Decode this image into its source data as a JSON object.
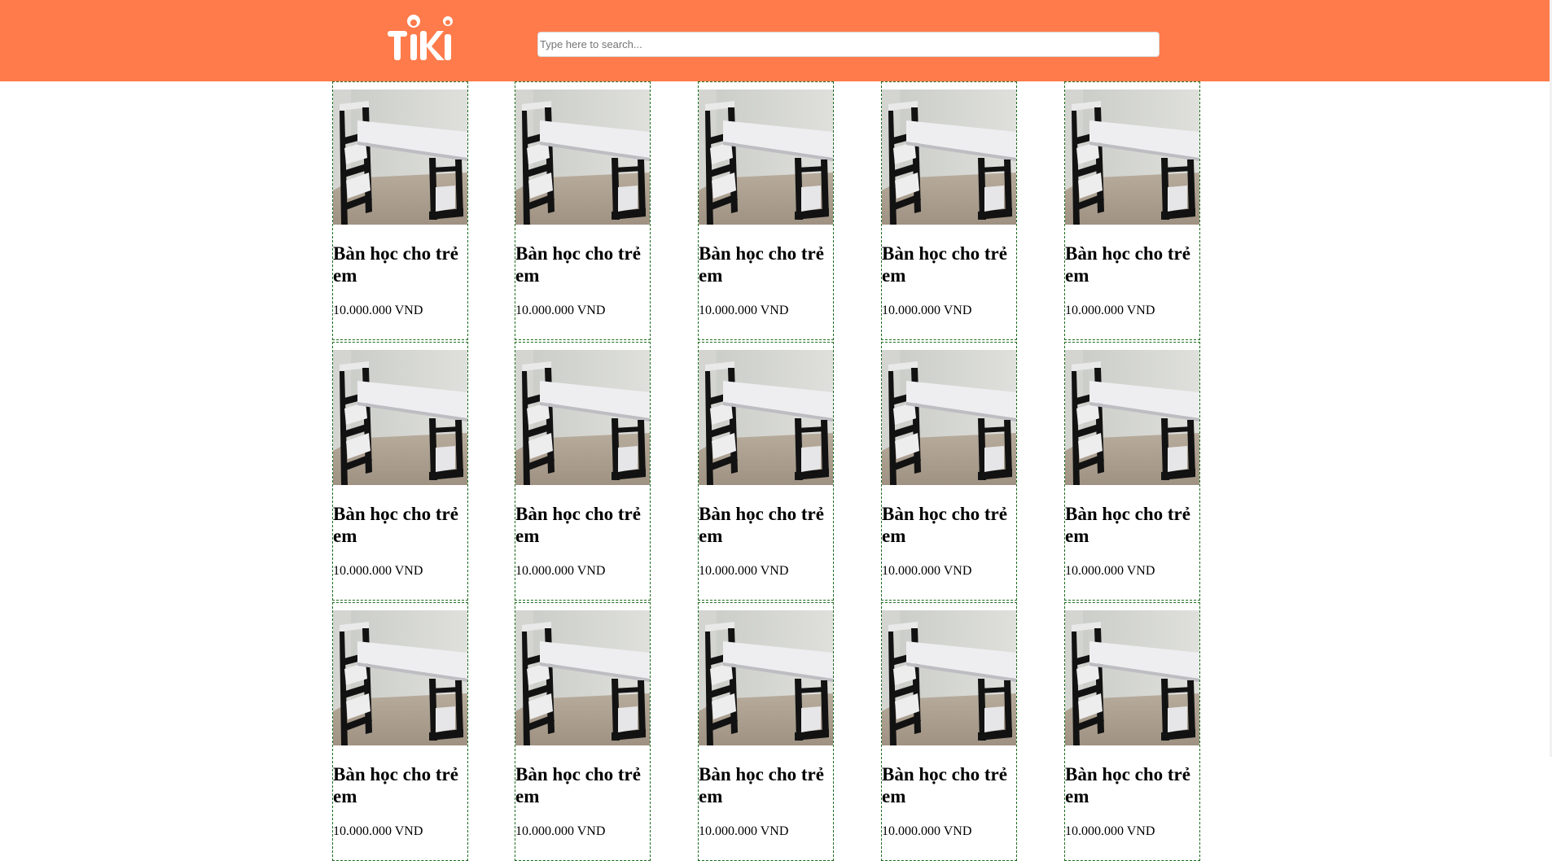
{
  "header": {
    "logo_text": "TIKI",
    "search_placeholder": "Type here to search..."
  },
  "products": [
    {
      "name": "Bàn học cho trẻ em",
      "price": "10.000.000 VND"
    },
    {
      "name": "Bàn học cho trẻ em",
      "price": "10.000.000 VND"
    },
    {
      "name": "Bàn học cho trẻ em",
      "price": "10.000.000 VND"
    },
    {
      "name": "Bàn học cho trẻ em",
      "price": "10.000.000 VND"
    },
    {
      "name": "Bàn học cho trẻ em",
      "price": "10.000.000 VND"
    },
    {
      "name": "Bàn học cho trẻ em",
      "price": "10.000.000 VND"
    },
    {
      "name": "Bàn học cho trẻ em",
      "price": "10.000.000 VND"
    },
    {
      "name": "Bàn học cho trẻ em",
      "price": "10.000.000 VND"
    },
    {
      "name": "Bàn học cho trẻ em",
      "price": "10.000.000 VND"
    },
    {
      "name": "Bàn học cho trẻ em",
      "price": "10.000.000 VND"
    },
    {
      "name": "Bàn học cho trẻ em",
      "price": "10.000.000 VND"
    },
    {
      "name": "Bàn học cho trẻ em",
      "price": "10.000.000 VND"
    },
    {
      "name": "Bàn học cho trẻ em",
      "price": "10.000.000 VND"
    },
    {
      "name": "Bàn học cho trẻ em",
      "price": "10.000.000 VND"
    },
    {
      "name": "Bàn học cho trẻ em",
      "price": "10.000.000 VND"
    }
  ],
  "colors": {
    "header_bg": "#ff7b4b",
    "card_border": "#1d6b1d"
  }
}
